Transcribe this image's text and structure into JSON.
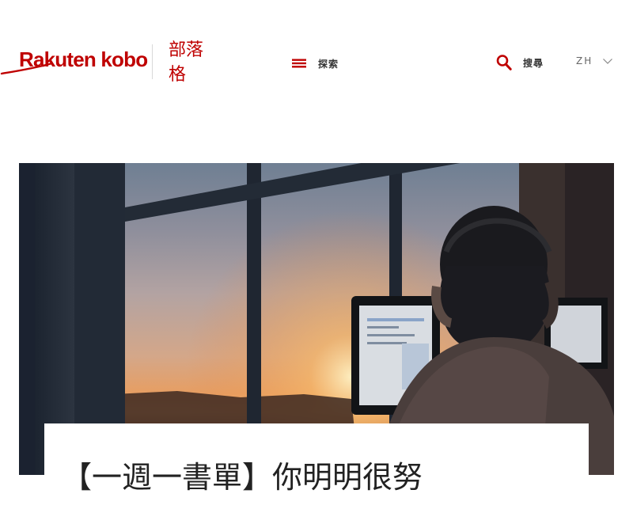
{
  "header": {
    "logo_text": "Rakuten kobo",
    "blog_label": "部落格",
    "explore_label": "探索",
    "search_label": "搜尋",
    "language": "ZH"
  },
  "hero": {
    "article_title": "【一週一書單】你明明很努"
  },
  "colors": {
    "brand": "#bf0000",
    "text": "#333333",
    "accent_icon": "#bf0000"
  },
  "icons": {
    "menu": "hamburger-menu-icon",
    "search": "magnifier-icon",
    "language_toggle": "chevron-down-icon"
  }
}
